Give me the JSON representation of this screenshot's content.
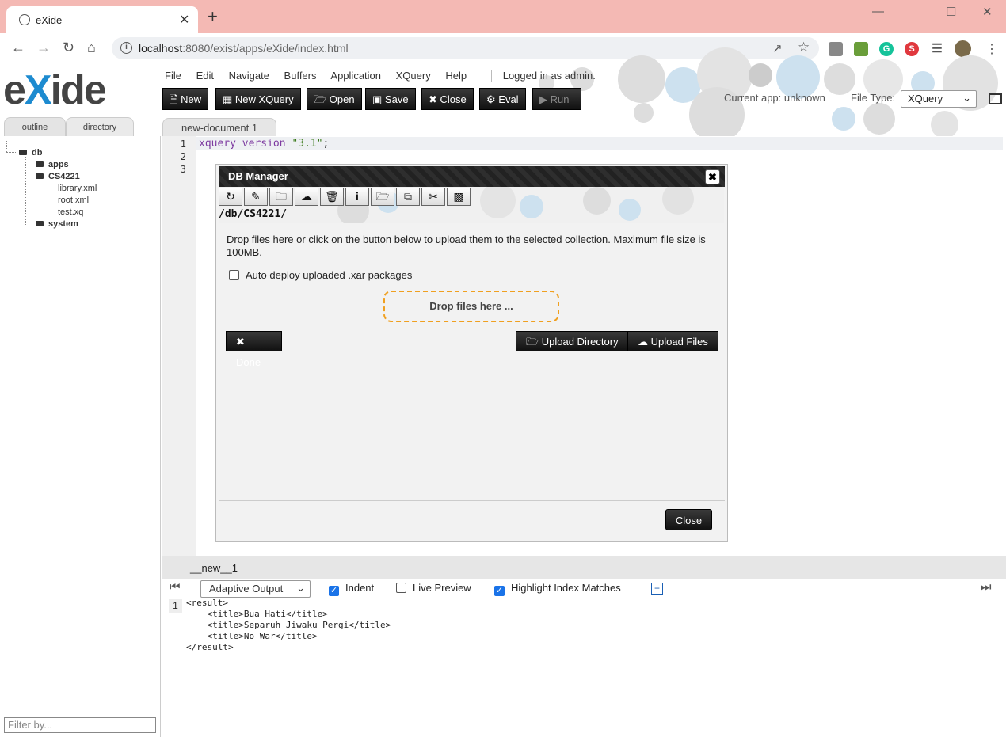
{
  "browser": {
    "tab_title": "eXide",
    "tab_close": "✕",
    "new_tab": "+",
    "url_host": "localhost",
    "url_rest": ":8080/exist/apps/eXide/index.html",
    "window_controls": [
      "—",
      "☐",
      "✕"
    ]
  },
  "app": {
    "logo_left": "e",
    "logo_x": "X",
    "logo_right": "ide",
    "menu": [
      "File",
      "Edit",
      "Navigate",
      "Buffers",
      "Application",
      "XQuery",
      "Help"
    ],
    "login_status": "Logged in as admin.",
    "toolbar": {
      "new": "New",
      "new_xquery": "New XQuery",
      "open": "Open",
      "save": "Save",
      "close": "Close",
      "eval": "Eval",
      "run": "Run"
    },
    "current_app": "Current app: unknown",
    "file_type_label": "File Type:",
    "file_type_value": "XQuery"
  },
  "sidebar": {
    "tabs": [
      "outline",
      "directory"
    ],
    "tree": {
      "db": "db",
      "apps": "apps",
      "cs4221": "CS4221",
      "library": "library.xml",
      "root": "root.xml",
      "test": "test.xq",
      "system": "system"
    },
    "filter_placeholder": "Filter by..."
  },
  "editor": {
    "doc_tab": "new-document 1",
    "line_numbers": [
      "1",
      "2",
      "3"
    ],
    "code_kw": "xquery version ",
    "code_str": "\"3.1\"",
    "code_end": ";"
  },
  "db_manager": {
    "title": "DB Manager",
    "close_x": "✖",
    "path": "/db/CS4221/",
    "drop_info": "Drop files here or click on the button below to upload them to the selected collection. Maximum file size is 100MB.",
    "auto_deploy": "Auto deploy uploaded .xar packages",
    "drop_zone": "Drop files here ...",
    "done": "Done",
    "upload_directory": "Upload Directory",
    "upload_files": "Upload Files",
    "close": "Close"
  },
  "output": {
    "buffer_label": "__new__1",
    "mode": "Adaptive Output",
    "indent": "Indent",
    "live_preview": "Live Preview",
    "highlight": "Highlight Index Matches",
    "gutter": "1",
    "lines": [
      "<result>",
      "    <title>Bua Hati</title>",
      "    <title>Separuh Jiwaku Pergi</title>",
      "    <title>No War</title>",
      "</result>"
    ]
  }
}
